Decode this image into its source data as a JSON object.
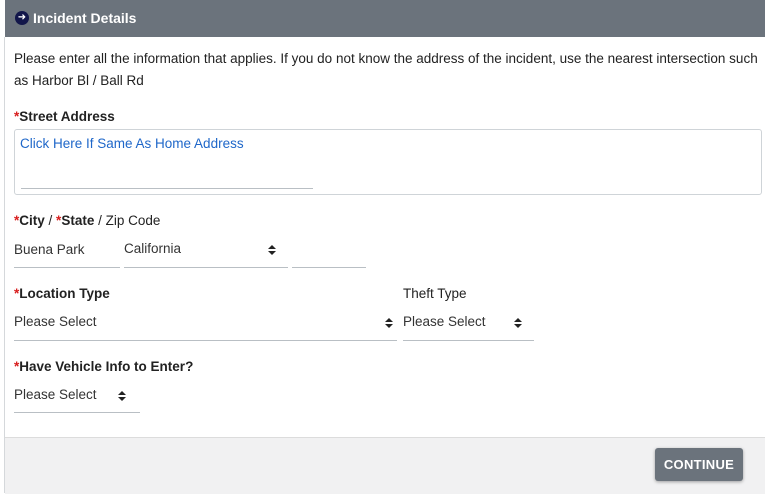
{
  "header": {
    "title": "Incident Details",
    "icon": "arrow-right-circle-icon"
  },
  "intro": "Please enter all the information that applies. If you do not know the address of the incident, use the nearest intersection such as Harbor Bl / Ball Rd",
  "required_mark": "*",
  "street_address": {
    "label": "Street Address",
    "same_as_home_link": "Click Here If Same As Home Address",
    "value": ""
  },
  "city_state_zip": {
    "label_city": "City",
    "separator": " / ",
    "label_state": "State",
    "label_zip": "Zip Code",
    "city_value": "Buena Park",
    "state_value": "California",
    "zip_value": ""
  },
  "location_type": {
    "label": "Location Type",
    "value": "Please Select"
  },
  "theft_type": {
    "label": "Theft Type",
    "value": "Please Select"
  },
  "vehicle_info": {
    "label": "Have Vehicle Info to Enter?",
    "value": "Please Select"
  },
  "footer": {
    "continue_label": "CONTINUE"
  },
  "colors": {
    "header_bg": "#6b737c",
    "required": "#d81d1d",
    "link": "#1f67c9",
    "button_bg": "#6b737c"
  }
}
